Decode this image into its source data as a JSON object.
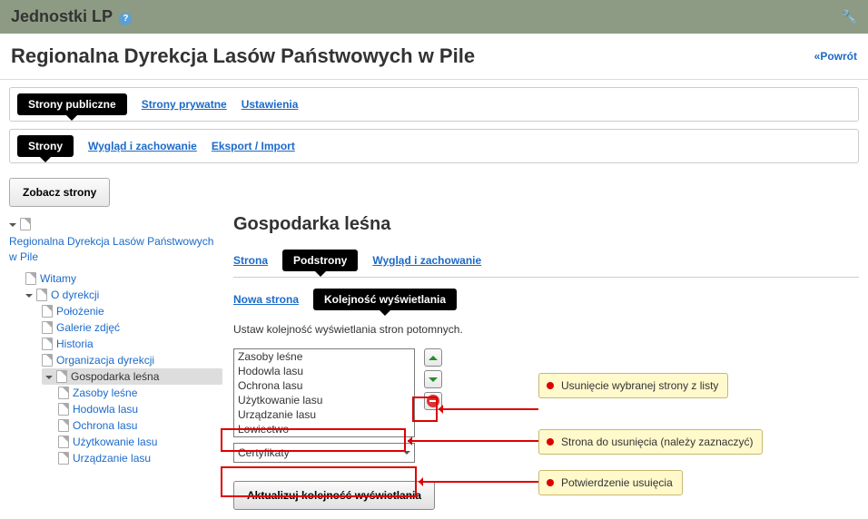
{
  "header": {
    "title": "Jednostki LP",
    "help_icon": "?",
    "wrench_icon": "🔧"
  },
  "subheader": {
    "title": "Regionalna Dyrekcja Lasów Państwowych w Pile",
    "back_link": "«Powrót"
  },
  "main_tabs": {
    "public": "Strony publiczne",
    "private": "Strony prywatne",
    "settings": "Ustawienia"
  },
  "section_tabs": {
    "pages": "Strony",
    "look": "Wygląd i zachowanie",
    "export": "Eksport / Import"
  },
  "view_pages_btn": "Zobacz strony",
  "tree": {
    "root": "Regionalna Dyrekcja Lasów Państwowych w Pile",
    "items": {
      "welcome": "Witamy",
      "about": "O dyrekcji",
      "location": "Położenie",
      "galleries": "Galerie zdjęć",
      "history": "Historia",
      "org": "Organizacja dyrekcji",
      "forestry": "Gospodarka leśna",
      "resources": "Zasoby leśne",
      "breeding": "Hodowla lasu",
      "protection": "Ochrona lasu",
      "use": "Użytkowanie lasu",
      "arrangement": "Urządzanie lasu"
    }
  },
  "content": {
    "title": "Gospodarka leśna",
    "page_tabs": {
      "page": "Strona",
      "subpages": "Podstrony",
      "look": "Wygląd i zachowanie"
    },
    "sub_tabs": {
      "new_page": "Nowa strona",
      "order": "Kolejność wyświetlania"
    },
    "desc": "Ustaw kolejność wyświetlania stron potomnych.",
    "order_list": [
      "Zasoby leśne",
      "Hodowla lasu",
      "Ochrona lasu",
      "Użytkowanie lasu",
      "Urządzanie lasu",
      "Łowiectwo"
    ],
    "dropdown_selected": "Certyfikaty",
    "update_btn": "Aktualizuj kolejność wyświetlania"
  },
  "callouts": {
    "remove": "Usunięcie wybranej strony z listy",
    "select": "Strona do usunięcia (należy zaznaczyć)",
    "confirm": "Potwierdzenie usuięcia"
  }
}
